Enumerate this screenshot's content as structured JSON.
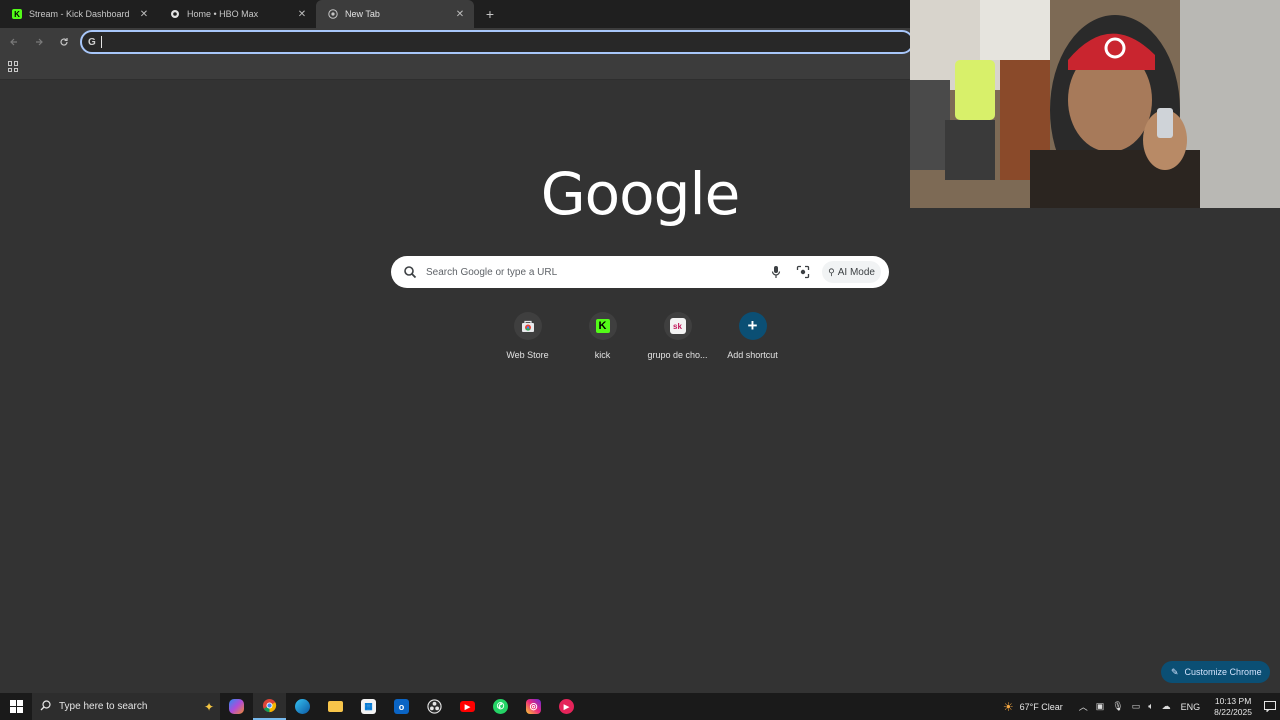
{
  "browser": {
    "tabs": [
      {
        "title": "Stream - Kick Dashboard",
        "favicon": "kick-icon",
        "active": false
      },
      {
        "title": "Home • HBO Max",
        "favicon": "hbo-icon",
        "active": false
      },
      {
        "title": "New Tab",
        "favicon": "chrome-icon",
        "active": true
      }
    ],
    "omnibox": {
      "value": "",
      "icon": "google-g-icon"
    }
  },
  "newtab": {
    "logo": "Google",
    "search": {
      "placeholder": "Search Google or type a URL",
      "ai_mode_label": "AI Mode"
    },
    "shortcuts": [
      {
        "label": "Web Store",
        "icon": "web-store-icon"
      },
      {
        "label": "kick",
        "icon": "kick-icon",
        "glyph": "K"
      },
      {
        "label": "grupo de cho...",
        "icon": "sk-icon",
        "glyph": "sk"
      },
      {
        "label": "Add shortcut",
        "icon": "plus-icon",
        "glyph": "+"
      }
    ],
    "customize_label": "Customize Chrome"
  },
  "taskbar": {
    "search_placeholder": "Type here to search",
    "weather": "67°F  Clear",
    "language": "ENG",
    "time": "10:13 PM",
    "date": "8/22/2025"
  },
  "colors": {
    "page_bg": "#333333",
    "accent_blue": "#0b4f74",
    "kick_green": "#53fc18"
  }
}
